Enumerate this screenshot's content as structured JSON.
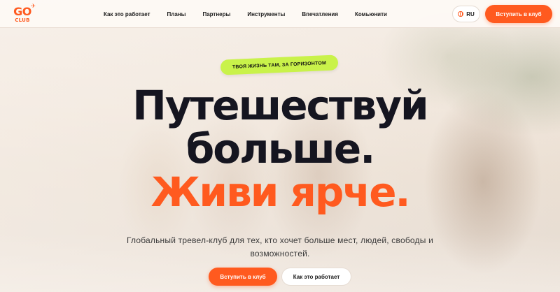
{
  "brand": {
    "logo_top": "GO",
    "logo_bottom": "CLUB",
    "accent": "#ff5a1f",
    "lime": "#c9f24a"
  },
  "nav": {
    "items": [
      {
        "label": "Как это работает"
      },
      {
        "label": "Планы"
      },
      {
        "label": "Партнеры"
      },
      {
        "label": "Инструменты"
      },
      {
        "label": "Впечатления"
      },
      {
        "label": "Комьюнити"
      }
    ]
  },
  "header": {
    "lang": "RU",
    "join_label": "Вступить в клуб"
  },
  "hero": {
    "badge": "ТВОЯ ЖИЗНЬ ТАМ, ЗА ГОРИЗОНТОМ",
    "line1": "Путешествуй",
    "line2": "больше.",
    "line3": "Живи ярче.",
    "subtitle": "Глобальный тревел-клуб для тех, кто хочет больше мест, людей, свободы и возможностей.",
    "cta_primary": "Вступить в клуб",
    "cta_secondary": "Как это работает"
  },
  "icons": {
    "logo_plane": "plane-icon",
    "lang": "globe-icon"
  }
}
